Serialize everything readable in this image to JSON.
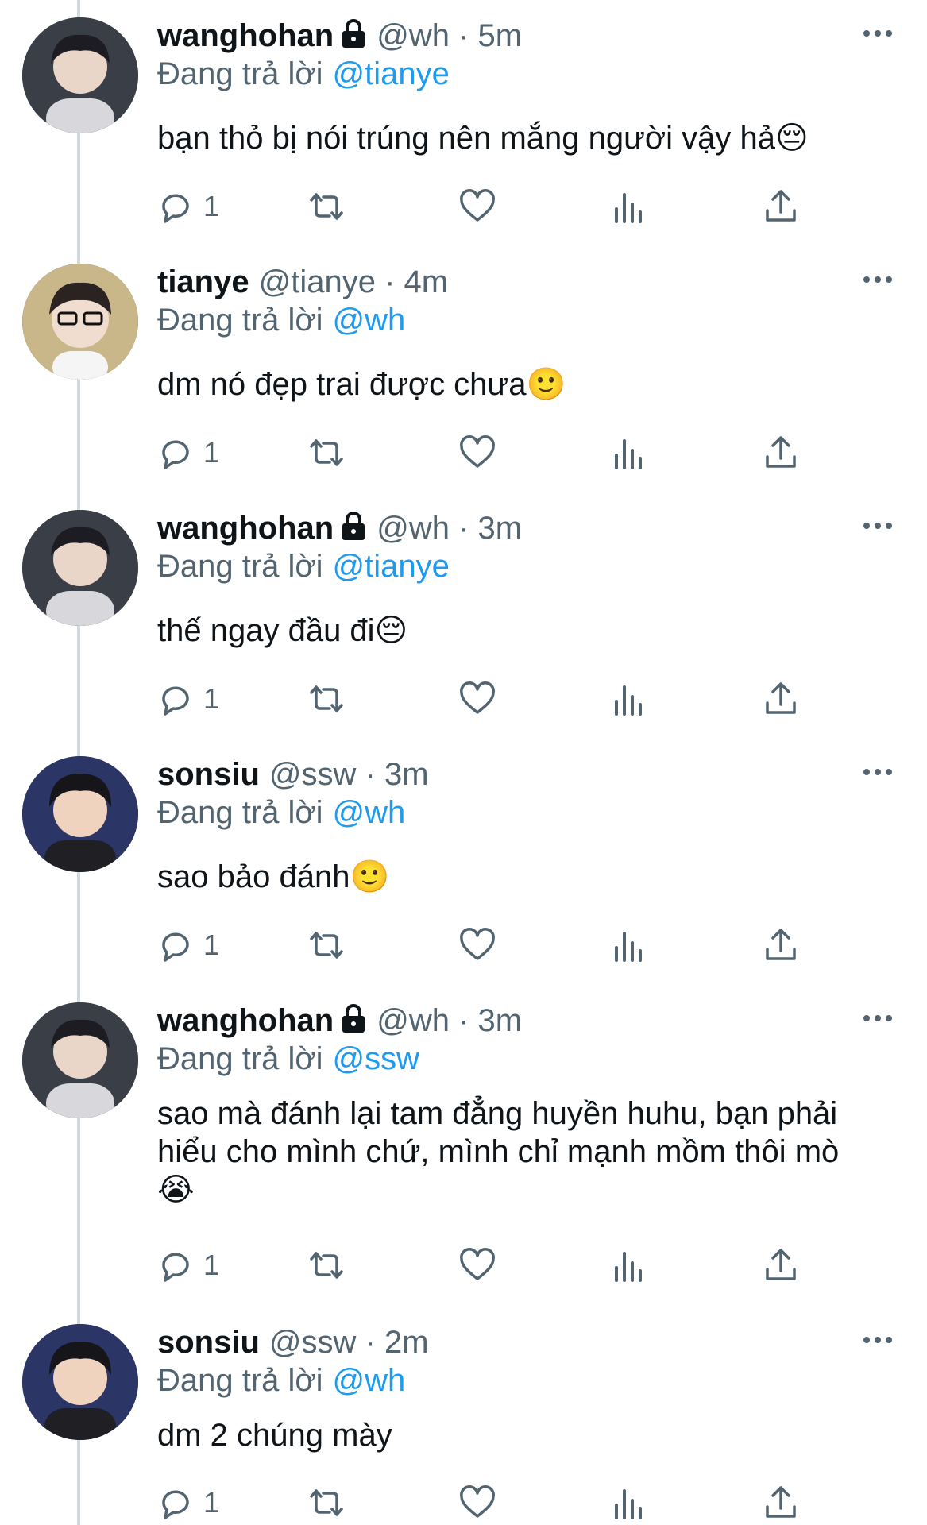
{
  "tweets": [
    {
      "name": "wanghohan",
      "locked": true,
      "handle": "@wh",
      "time": "5m",
      "reply_prefix": "Đang trả lời",
      "reply_to": "@tianye",
      "text": "bạn thỏ bị nói trúng nên mắng người vậy hả😔",
      "reply_count": "1"
    },
    {
      "name": "tianye",
      "locked": false,
      "handle": "@tianye",
      "time": "4m",
      "reply_prefix": "Đang trả lời",
      "reply_to": "@wh",
      "text": "dm nó đẹp trai được chưa🙂",
      "reply_count": "1"
    },
    {
      "name": "wanghohan",
      "locked": true,
      "handle": "@wh",
      "time": "3m",
      "reply_prefix": "Đang trả lời",
      "reply_to": "@tianye",
      "text": "thế ngay đầu đi😔",
      "reply_count": "1"
    },
    {
      "name": "sonsiu",
      "locked": false,
      "handle": "@ssw",
      "time": "3m",
      "reply_prefix": "Đang trả lời",
      "reply_to": "@wh",
      "text": "sao bảo đánh🙂",
      "reply_count": "1"
    },
    {
      "name": "wanghohan",
      "locked": true,
      "handle": "@wh",
      "time": "3m",
      "reply_prefix": "Đang trả lời",
      "reply_to": "@ssw",
      "text": "sao mà đánh lại tam đẳng huyền huhu, bạn phải hiểu cho mình chứ, mình chỉ mạnh mồm thôi mò 😭",
      "reply_count": "1"
    },
    {
      "name": "sonsiu",
      "locked": false,
      "handle": "@ssw",
      "time": "2m",
      "reply_prefix": "Đang trả lời",
      "reply_to": "@wh",
      "text": "dm 2 chúng mày",
      "reply_count": "1"
    }
  ],
  "separator": "·",
  "colors": {
    "accent": "#1d9bf0",
    "secondary_text": "#536471",
    "thread_line": "#cfd9de"
  },
  "icons": [
    "lock-icon",
    "more-icon",
    "reply-icon",
    "retweet-icon",
    "like-icon",
    "views-icon",
    "share-icon"
  ]
}
